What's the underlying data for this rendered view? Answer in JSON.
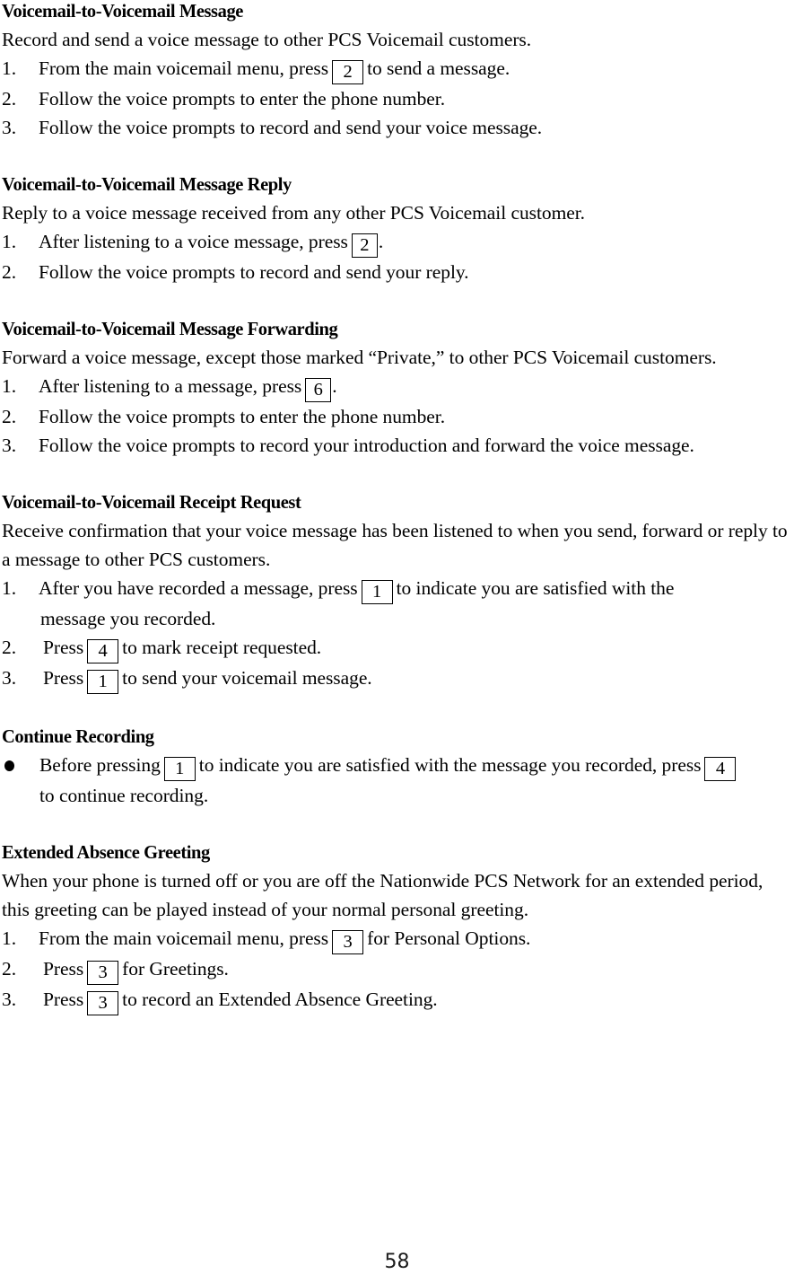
{
  "document": {
    "page_number": "58",
    "sections": [
      {
        "heading": "Voicemail-to-Voicemail Message",
        "intro": "Record and send a voice message to other PCS Voicemail customers.",
        "list_type": "ordered",
        "items": [
          {
            "marker": "1.",
            "pre": "From the main voicemail menu, press",
            "key": "2",
            "post": "to send a message."
          },
          {
            "marker": "2.",
            "pre": "Follow the voice prompts to enter the phone number.",
            "key": "",
            "post": ""
          },
          {
            "marker": "3.",
            "pre": "Follow the voice prompts to record and send your voice message.",
            "key": "",
            "post": ""
          }
        ]
      },
      {
        "heading": "Voicemail-to-Voicemail Message Reply",
        "intro": "Reply to a voice message received from any other PCS Voicemail customer.",
        "list_type": "ordered",
        "items": [
          {
            "marker": "1.",
            "pre": "After listening to a voice message, press",
            "key": "2",
            "post": "."
          },
          {
            "marker": "2.",
            "pre": "Follow the voice prompts to record and send your reply.",
            "key": "",
            "post": ""
          }
        ]
      },
      {
        "heading": "Voicemail-to-Voicemail Message Forwarding",
        "intro": "Forward a voice message, except those marked “Private,” to other PCS Voicemail customers.",
        "list_type": "ordered",
        "items": [
          {
            "marker": "1.",
            "pre": "After listening to a message, press",
            "key": "6",
            "post": "."
          },
          {
            "marker": "2.",
            "pre": "Follow the voice prompts to enter the phone number.",
            "key": "",
            "post": ""
          },
          {
            "marker": "3.",
            "pre": "Follow the voice prompts to record your introduction and forward the voice message.",
            "key": "",
            "post": ""
          }
        ]
      },
      {
        "heading": "Voicemail-to-Voicemail Receipt Request",
        "intro": "Receive confirmation that your voice message has been listened to when you send, forward or reply to a message to other PCS customers.",
        "list_type": "ordered",
        "items": [
          {
            "marker": "1.",
            "pre": "After you have recorded a message, press",
            "key": "1",
            "post": "to indicate you are satisfied with the",
            "continuation": "message you recorded."
          },
          {
            "marker": "2.",
            "pre": "Press",
            "key": "4",
            "post": "to mark receipt requested."
          },
          {
            "marker": "3.",
            "pre": "Press",
            "key": "1",
            "post": "to send your voicemail message."
          }
        ]
      },
      {
        "heading": "Continue Recording",
        "intro": "",
        "list_type": "bullet",
        "items": [
          {
            "marker": "●",
            "pre": "Before pressing",
            "key": "1",
            "post": "to indicate you are satisfied with the message you recorded, press",
            "key2": "4",
            "continuation": "to continue recording."
          }
        ]
      },
      {
        "heading": "Extended Absence Greeting",
        "intro": "When your phone is turned off or you are off the Nationwide PCS Network for an extended period, this greeting can be played instead of your normal personal greeting.",
        "list_type": "ordered",
        "items": [
          {
            "marker": "1.",
            "pre": "From the main voicemail menu, press",
            "key": "3",
            "post": "for Personal Options."
          },
          {
            "marker": "2.",
            "pre": "Press",
            "key": "3",
            "post": "for Greetings."
          },
          {
            "marker": "3.",
            "pre": "Press",
            "key": "3",
            "post": "to record an Extended Absence Greeting."
          }
        ]
      }
    ]
  }
}
